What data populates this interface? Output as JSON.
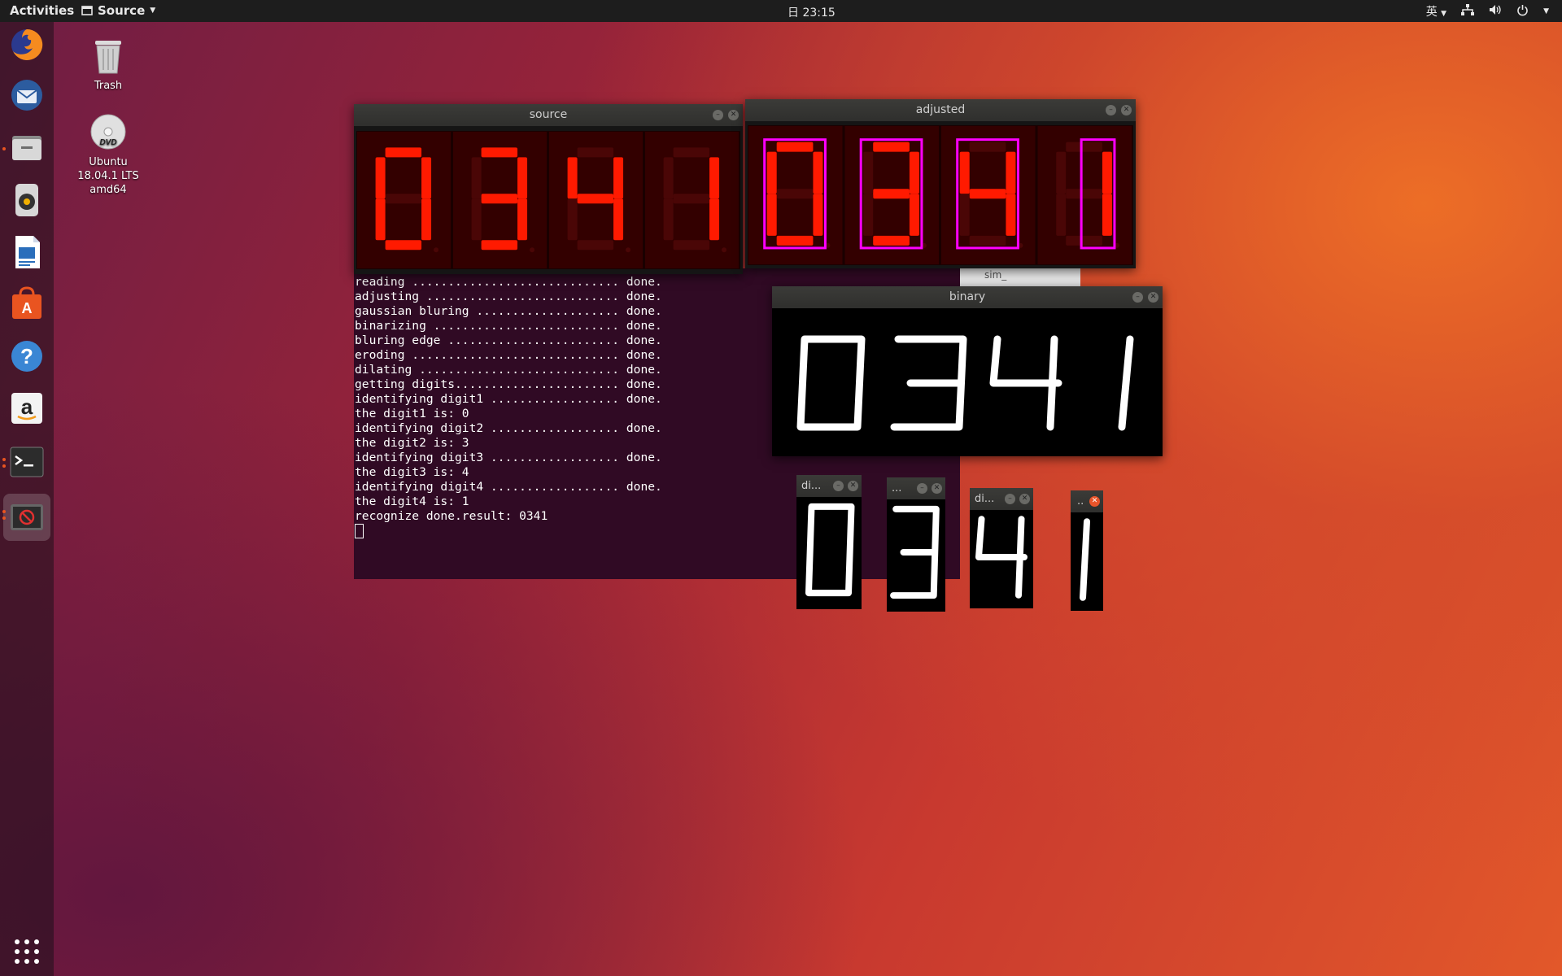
{
  "topbar": {
    "activities": "Activities",
    "app_menu": "Source",
    "clock": "日 23:15",
    "input_method": "英"
  },
  "desktop": {
    "trash_label": "Trash",
    "dvd_label_1": "Ubuntu",
    "dvd_label_2": "18.04.1 LTS",
    "dvd_label_3": "amd64",
    "dvd_badge": "DVD"
  },
  "dock": {
    "items": [
      "firefox-icon",
      "thunderbird-icon",
      "files-icon",
      "rhythmbox-icon",
      "writer-icon",
      "software-icon",
      "help-icon",
      "amazon-icon",
      "terminal-icon",
      "image-viewer-icon",
      "app-grid-icon"
    ]
  },
  "windows": {
    "source_title": "source",
    "adjusted_title": "adjusted",
    "binary_title": "binary",
    "digit1_title": "di...",
    "digit2_title": "...",
    "digit3_title": "di...",
    "digit4_title": ".."
  },
  "background_window": {
    "partial_text": "sim_"
  },
  "digits": [
    "0",
    "3",
    "4",
    "1"
  ],
  "terminal": {
    "lines": [
      "reading ............................. done.",
      "adjusting ........................... done.",
      "gaussian bluring .................... done.",
      "binarizing .......................... done.",
      "bluring edge ........................ done.",
      "eroding ............................. done.",
      "dilating ............................ done.",
      "getting digits....................... done.",
      "identifying digit1 .................. done.",
      "the digit1 is: 0",
      "identifying digit2 .................. done.",
      "the digit2 is: 3",
      "identifying digit3 .................. done.",
      "the digit3 is: 4",
      "identifying digit4 .................. done.",
      "the digit4 is: 1",
      "recognize done.result: 0341"
    ]
  },
  "colors": {
    "segment_red": "#ff1a00",
    "magenta_box": "#ff00ff",
    "terminal_bg": "#300a24",
    "accent": "#e95420"
  }
}
